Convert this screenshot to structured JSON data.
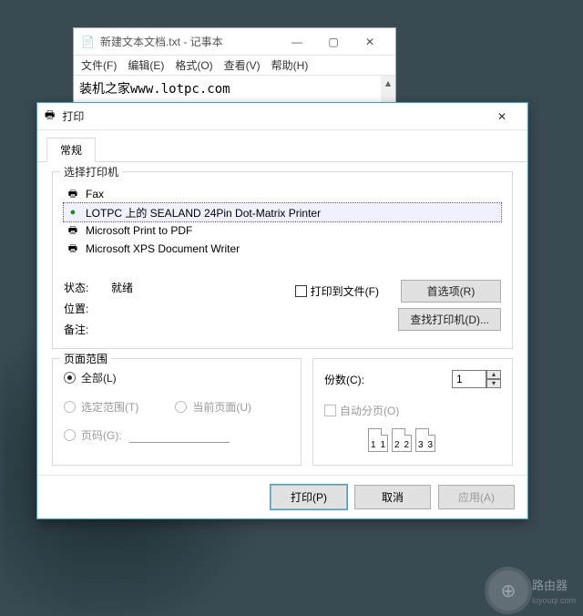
{
  "notepad": {
    "title": "新建文本文档.txt - 记事本",
    "menu": {
      "file": "文件(F)",
      "edit": "编辑(E)",
      "format": "格式(O)",
      "view": "查看(V)",
      "help": "帮助(H)"
    },
    "content": "装机之家www.lotpc.com"
  },
  "dialog": {
    "title": "打印",
    "tab_general": "常规",
    "select_printer_label": "选择打印机",
    "printers": [
      {
        "name": "Fax"
      },
      {
        "name": "LOTPC 上的 SEALAND 24Pin Dot-Matrix Printer"
      },
      {
        "name": "Microsoft Print to PDF"
      },
      {
        "name": "Microsoft XPS Document Writer"
      }
    ],
    "status_label": "状态:",
    "status_value": "就绪",
    "location_label": "位置:",
    "comment_label": "备注:",
    "print_to_file": "打印到文件(F)",
    "preferences_btn": "首选项(R)",
    "find_printer_btn": "查找打印机(D)...",
    "page_range_label": "页面范围",
    "range_all": "全部(L)",
    "range_selection": "选定范围(T)",
    "range_current": "当前页面(U)",
    "range_pages": "页码(G):",
    "copies_label": "份数(C):",
    "copies_value": "1",
    "collate_label": "自动分页(O)",
    "collate_pages": [
      "1",
      "1",
      "2",
      "2",
      "3",
      "3"
    ],
    "print_btn": "打印(P)",
    "cancel_btn": "取消",
    "apply_btn": "应用(A)"
  },
  "watermark": {
    "brand": "路由器",
    "site": "luyouqi.com"
  }
}
